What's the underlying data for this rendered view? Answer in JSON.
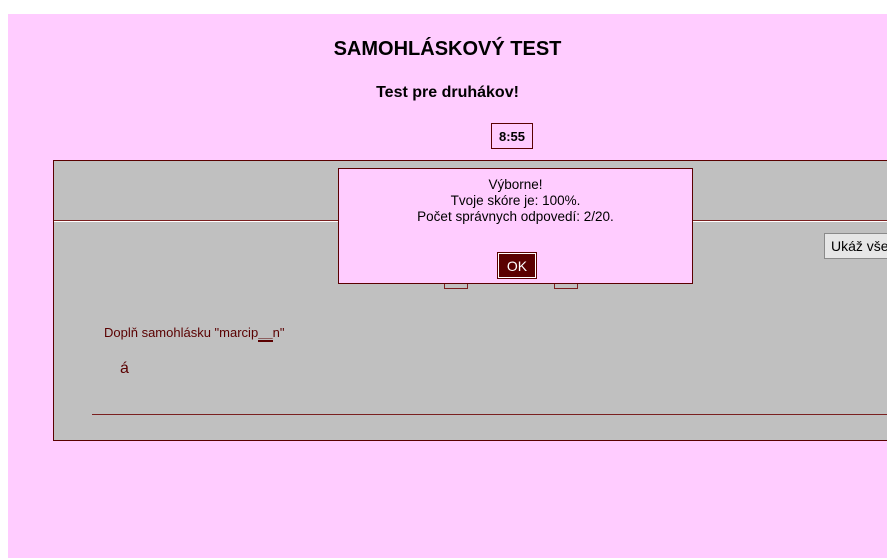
{
  "header": {
    "title": "SAMOHLÁSKOVÝ TEST",
    "subtitle": "Test pre druhákov!",
    "timer": "8:55"
  },
  "quiz": {
    "show_all_label": "Ukáž vše",
    "question_prefix": "Doplň samohlásku \"marcip",
    "question_blank": "__",
    "question_suffix": "n\"",
    "answer": "á"
  },
  "dialog": {
    "line1": "Výborne!",
    "line2": "Tvoje skóre je: 100%.",
    "line3": "Počet správnych odpovedí: 2/20.",
    "ok_label": "OK"
  },
  "colors": {
    "page_background": "#ffccff",
    "panel_background": "#c0c0c0",
    "accent": "#5a0000"
  }
}
